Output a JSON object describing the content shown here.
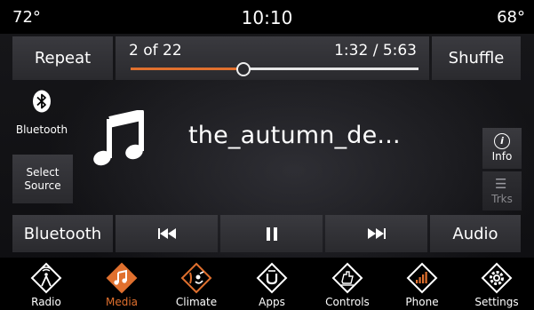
{
  "status": {
    "temp_left": "72°",
    "clock": "10:10",
    "temp_right": "68°"
  },
  "media": {
    "repeat_label": "Repeat",
    "shuffle_label": "Shuffle",
    "track_count": "2 of 22",
    "time": "1:32 / 5:63",
    "progress": 0.39,
    "source_name": "Bluetooth",
    "select_source_line1": "Select",
    "select_source_line2": "Source",
    "song_title": "the_autumn_de...",
    "info_label": "Info",
    "tracks_label": "Trks"
  },
  "transport": {
    "bluetooth_label": "Bluetooth",
    "audio_label": "Audio"
  },
  "nav": [
    {
      "label": "Radio",
      "icon": "radio-icon"
    },
    {
      "label": "Media",
      "icon": "media-icon",
      "active": true
    },
    {
      "label": "Climate",
      "icon": "climate-icon"
    },
    {
      "label": "Apps",
      "icon": "apps-icon"
    },
    {
      "label": "Controls",
      "icon": "controls-icon"
    },
    {
      "label": "Phone",
      "icon": "phone-icon"
    },
    {
      "label": "Settings",
      "icon": "settings-icon"
    }
  ],
  "colors": {
    "accent": "#e0702e",
    "button_bg": "#323236",
    "background": "#0d0d10"
  }
}
